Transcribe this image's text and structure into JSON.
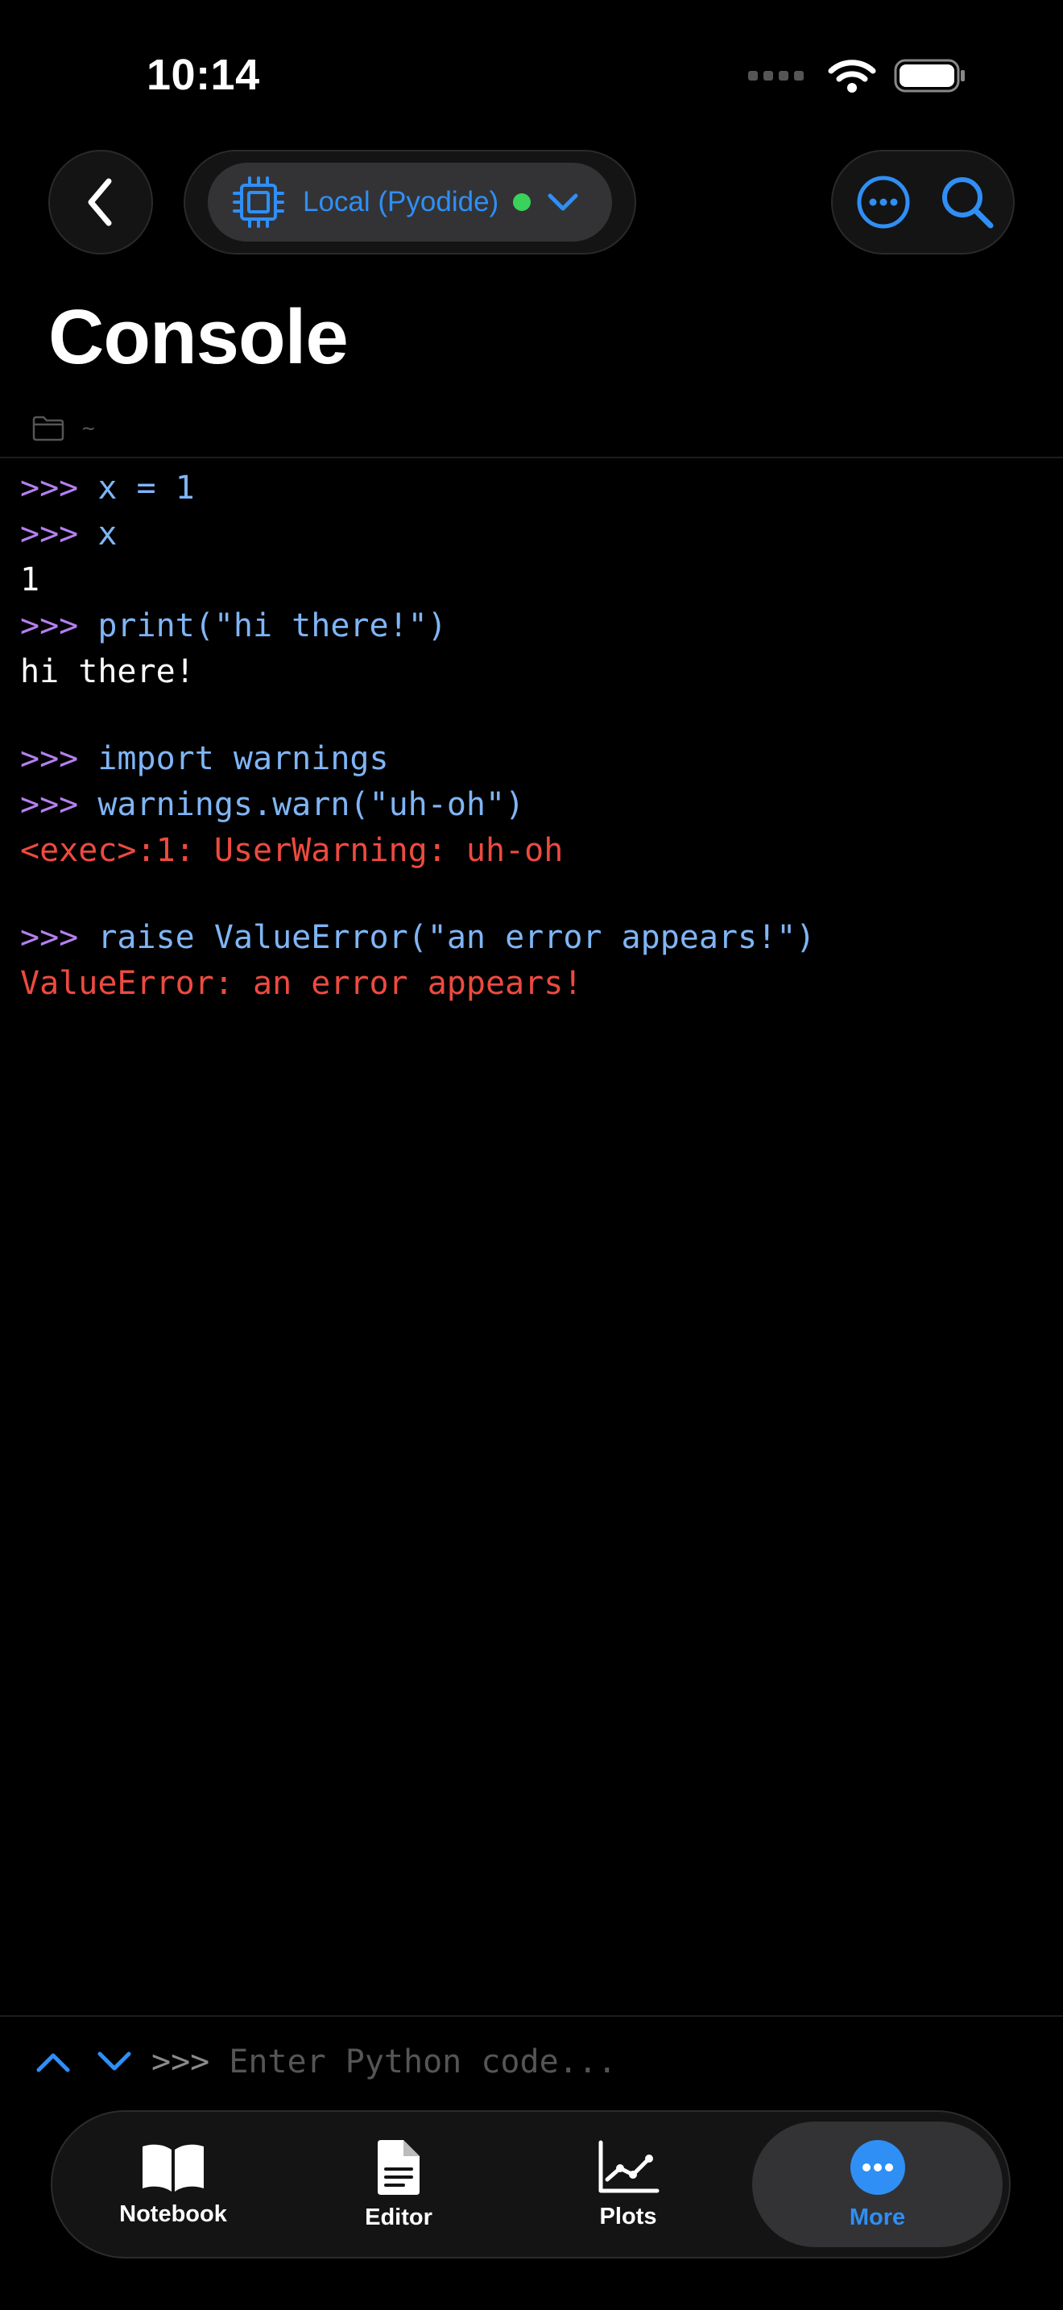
{
  "status_bar": {
    "time": "10:14"
  },
  "nav": {
    "kernel_label": "Local (Pyodide)",
    "kernel_status_color": "#3ad25a",
    "accent_color": "#2f8ff5"
  },
  "title": "Console",
  "path": "~",
  "console": {
    "lines": [
      {
        "type": "input",
        "prompt": ">>>",
        "code": "x = 1"
      },
      {
        "type": "input",
        "prompt": ">>>",
        "code": "x"
      },
      {
        "type": "output",
        "text": "1"
      },
      {
        "type": "input",
        "prompt": ">>>",
        "code": "print(\"hi there!\")"
      },
      {
        "type": "output",
        "text": "hi there!"
      },
      {
        "type": "blank"
      },
      {
        "type": "input",
        "prompt": ">>>",
        "code": "import warnings"
      },
      {
        "type": "input",
        "prompt": ">>>",
        "code": "warnings.warn(\"uh-oh\")"
      },
      {
        "type": "error",
        "text": "<exec>:1: UserWarning: uh-oh"
      },
      {
        "type": "blank"
      },
      {
        "type": "input",
        "prompt": ">>>",
        "code": "raise ValueError(\"an error appears!\")"
      },
      {
        "type": "error",
        "text": "ValueError: an error appears!"
      }
    ]
  },
  "input": {
    "prompt": ">>>",
    "placeholder": "Enter Python code..."
  },
  "tabs": [
    {
      "label": "Notebook",
      "icon": "book-icon",
      "active": false
    },
    {
      "label": "Editor",
      "icon": "document-icon",
      "active": false
    },
    {
      "label": "Plots",
      "icon": "chart-icon",
      "active": false
    },
    {
      "label": "More",
      "icon": "ellipsis-circle-icon",
      "active": true
    }
  ]
}
